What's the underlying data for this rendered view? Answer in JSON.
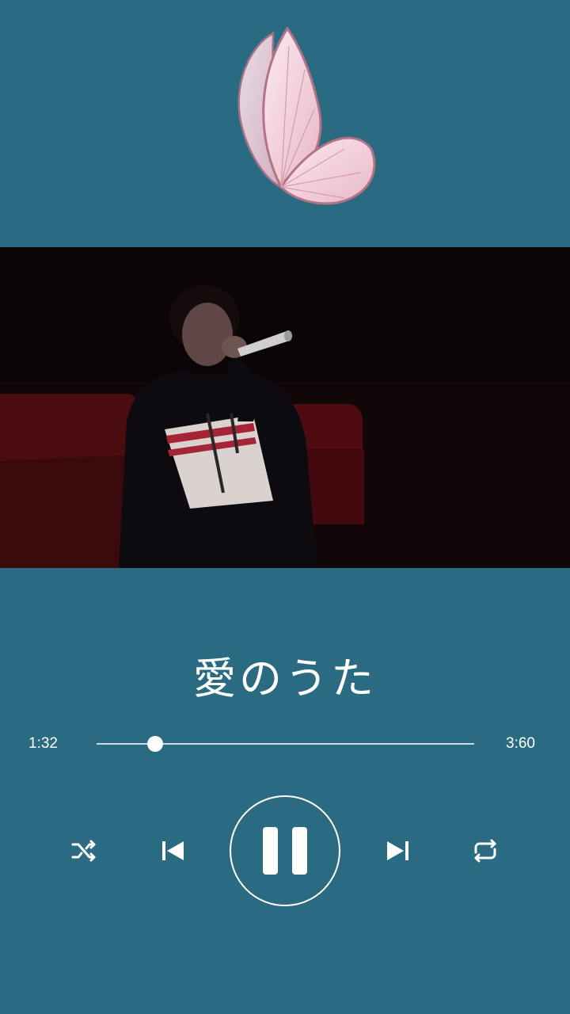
{
  "song": {
    "title": "愛のうた"
  },
  "progress": {
    "current": "1:32",
    "total": "3:60",
    "fraction": 0.155
  },
  "icons": {
    "decor": "butterfly-icon",
    "shuffle": "shuffle-icon",
    "prev": "skip-previous-icon",
    "play_pause": "pause-icon",
    "next": "skip-next-icon",
    "repeat": "repeat-icon"
  },
  "colors": {
    "background": "#2a6b82",
    "foreground": "#ffffff",
    "butterfly": "#f2cfdc"
  }
}
